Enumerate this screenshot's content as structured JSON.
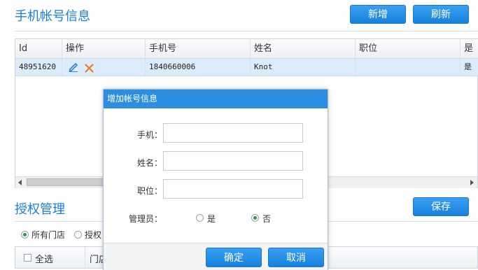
{
  "header": {
    "title": "手机帐号信息",
    "add_label": "新增",
    "refresh_label": "刷新"
  },
  "table": {
    "columns": [
      "Id",
      "操作",
      "手机号",
      "姓名",
      "职位",
      "是"
    ],
    "rows": [
      {
        "id": "48951620",
        "phone": "1840660006",
        "name": "Knot",
        "position": "",
        "last": "是"
      }
    ]
  },
  "auth": {
    "title": "授权管理",
    "save_label": "保存",
    "radio_all": "所有门店",
    "radio_part": "授权",
    "col_select_all": "全选",
    "col_store": "门店"
  },
  "dialog": {
    "title": "增加帐号信息",
    "phone_label": "手机：",
    "name_label": "姓名：",
    "position_label": "职位：",
    "admin_label": "管理员：",
    "yes_label": "是",
    "no_label": "否",
    "confirm_label": "确定",
    "cancel_label": "取消"
  },
  "colors": {
    "accent": "#1a7fd4",
    "button": "#2b8ee0",
    "row_highlight": "#dcecfb"
  }
}
